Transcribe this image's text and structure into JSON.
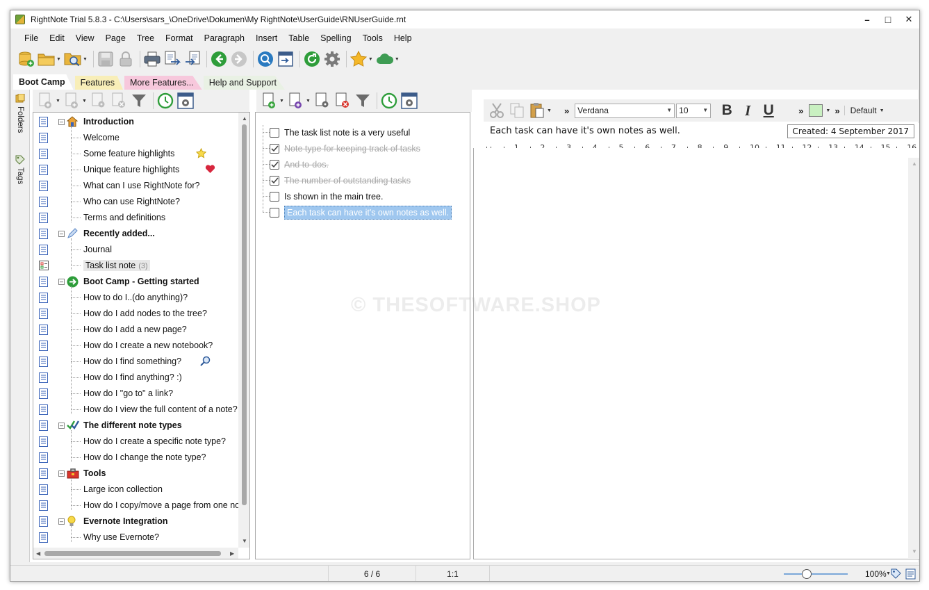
{
  "window": {
    "title": "RightNote Trial 5.8.3 - C:\\Users\\sars_\\OneDrive\\Dokumen\\My RightNote\\UserGuide\\RNUserGuide.rnt",
    "min": "–",
    "max": "□",
    "close": "✕"
  },
  "menu": [
    "File",
    "Edit",
    "View",
    "Page",
    "Tree",
    "Format",
    "Paragraph",
    "Insert",
    "Table",
    "Spelling",
    "Tools",
    "Help"
  ],
  "tabs": [
    {
      "label": "Boot Camp",
      "color": "#ffffff"
    },
    {
      "label": "Features",
      "color": "#f8eeb8"
    },
    {
      "label": "More Features...",
      "color": "#f7c8dc"
    },
    {
      "label": "Help and Support",
      "color": "#e9f1e4"
    }
  ],
  "side": {
    "folders": "Folders",
    "tags": "Tags"
  },
  "tree": [
    {
      "label": "Introduction",
      "bold": true,
      "icon": "home-icon"
    },
    {
      "label": "Welcome"
    },
    {
      "label": "Some feature highlights",
      "icon": "star-icon"
    },
    {
      "label": "Unique feature highlights",
      "icon": "heart-icon"
    },
    {
      "label": "What can I use RightNote for?"
    },
    {
      "label": "Who can use RightNote?"
    },
    {
      "label": "Terms and definitions"
    },
    {
      "label": "Recently added...",
      "bold": true,
      "icon": "pen-icon"
    },
    {
      "label": "Journal"
    },
    {
      "label": "Task list note",
      "count": "(3)",
      "selected": true
    },
    {
      "label": "Boot Camp - Getting started",
      "bold": true,
      "icon": "go-arrow-icon"
    },
    {
      "label": "How to do I..(do anything)?"
    },
    {
      "label": "How do I add nodes to the tree?"
    },
    {
      "label": "How do I add a new page?"
    },
    {
      "label": "How do I create a new notebook?"
    },
    {
      "label": "How do I find something?",
      "icon": "magnifier-icon"
    },
    {
      "label": "How do I find anything? :)"
    },
    {
      "label": "How do I \"go to\" a link?"
    },
    {
      "label": "How do I view the full content of a note?"
    },
    {
      "label": "The different note types",
      "bold": true,
      "icon": "check-icon"
    },
    {
      "label": "How do I create a specific note type?"
    },
    {
      "label": "How do I change the note type?"
    },
    {
      "label": "Tools",
      "bold": true,
      "icon": "toolbox-icon"
    },
    {
      "label": "Large icon collection"
    },
    {
      "label": "How do I copy/move a page from one not"
    },
    {
      "label": "Evernote Integration",
      "bold": true,
      "icon": "bulb-icon"
    },
    {
      "label": "Why use Evernote?"
    }
  ],
  "tasks": [
    {
      "label": "The task list note is a very useful",
      "done": false
    },
    {
      "label": "Note type for keeping track of tasks",
      "done": true
    },
    {
      "label": "And to-dos.",
      "done": true
    },
    {
      "label": "The number of outstanding tasks",
      "done": true
    },
    {
      "label": "Is shown in the main tree.",
      "done": false
    },
    {
      "label": "Each task can have it's own notes as well.",
      "done": false,
      "selected": true
    }
  ],
  "editor": {
    "font": "Verdana",
    "size": "10",
    "bold": "B",
    "italic": "I",
    "underline": "U",
    "more": "»",
    "style": "Default",
    "title": "Each task can have it's own notes as well.",
    "created": "Created: 4 September 2017",
    "ruler": [
      "1",
      "2",
      "3",
      "4",
      "5",
      "6",
      "7",
      "8",
      "9",
      "10",
      "11",
      "12",
      "13",
      "14",
      "15",
      "16"
    ]
  },
  "status": {
    "count": "6 / 6",
    "position": "1:1",
    "zoom": "100%"
  },
  "watermark": "© THESOFTWARE.SHOP",
  "colors": {
    "accent": "#2e9d3a",
    "selection": "#9fc7ef",
    "page_icon": "#3a63b8"
  }
}
